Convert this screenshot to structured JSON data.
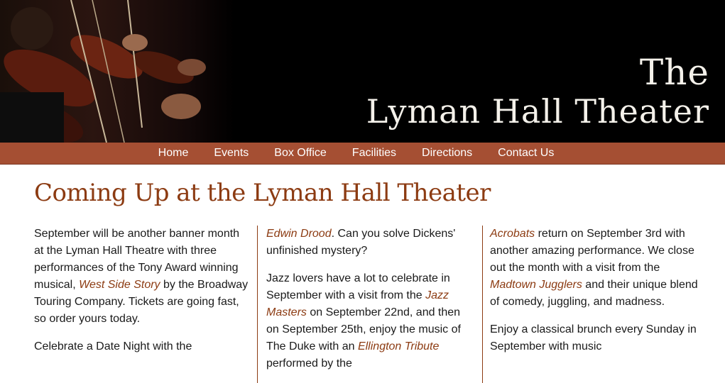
{
  "header": {
    "logo_line1": "The",
    "logo_line2": "Lyman Hall Theater"
  },
  "nav": {
    "items": [
      "Home",
      "Events",
      "Box Office",
      "Facilities",
      "Directions",
      "Contact Us"
    ]
  },
  "main": {
    "title": "Coming Up at the Lyman Hall Theater",
    "col1": {
      "p1_a": "September will be another banner month at the Lyman Hall Theatre with three performances of the Tony Award winning musical, ",
      "p1_link": "West Side Story",
      "p1_b": " by the Broadway Touring Company. Tickets are going fast, so order yours today.",
      "p2_a": "Celebrate a Date Night with the"
    },
    "col2": {
      "p1_link": "Edwin Drood",
      "p1_b": ". Can you solve Dickens' unfinished mystery?",
      "p2_a": "Jazz lovers have a lot to celebrate in September with a visit from the ",
      "p2_link1": "Jazz Masters",
      "p2_b": " on September 22nd, and then on September 25th, enjoy the music of The Duke with an ",
      "p2_link2": "Ellington Tribute",
      "p2_c": " performed by the"
    },
    "col3": {
      "p1_link1": "Acrobats",
      "p1_a": " return on September 3rd with another amazing performance. We close out the month with a visit from the ",
      "p1_link2": "Madtown Jugglers",
      "p1_b": " and their unique blend of comedy, juggling, and madness.",
      "p2_a": "Enjoy a classical brunch every Sunday in September with music"
    }
  }
}
